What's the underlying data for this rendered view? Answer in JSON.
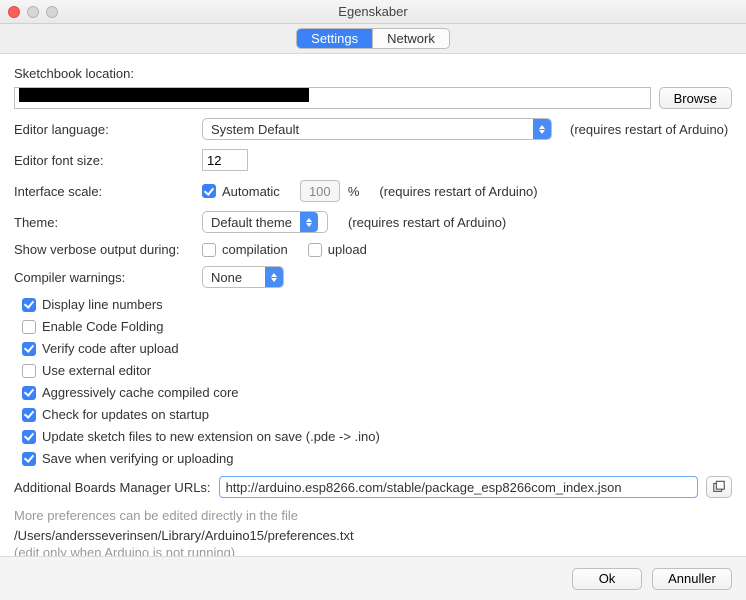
{
  "window": {
    "title": "Egenskaber"
  },
  "tabs": {
    "settings": "Settings",
    "network": "Network"
  },
  "labels": {
    "sketchbook": "Sketchbook location:",
    "language": "Editor language:",
    "fontsize": "Editor font size:",
    "interface_scale": "Interface scale:",
    "theme": "Theme:",
    "verbose": "Show verbose output during:",
    "compiler_warnings": "Compiler warnings:",
    "boards_url": "Additional Boards Manager URLs:"
  },
  "values": {
    "language": "System Default",
    "fontsize": "12",
    "scale_auto": "Automatic",
    "scale_pct": "100",
    "scale_pct_suffix": "%",
    "theme": "Default theme",
    "verbose_compile": "compilation",
    "verbose_upload": "upload",
    "compiler_warnings": "None",
    "boards_url": "http://arduino.esp8266.com/stable/package_esp8266com_index.json"
  },
  "hints": {
    "restart": "(requires restart of Arduino)"
  },
  "options": {
    "display_line_numbers": "Display line numbers",
    "enable_code_folding": "Enable Code Folding",
    "verify_after_upload": "Verify code after upload",
    "use_external_editor": "Use external editor",
    "cache_core": "Aggressively cache compiled core",
    "check_updates": "Check for updates on startup",
    "update_ext": "Update sketch files to new extension on save (.pde -> .ino)",
    "save_on_verify": "Save when verifying or uploading"
  },
  "footer": {
    "note1": "More preferences can be edited directly in the file",
    "path": "/Users/andersseverinsen/Library/Arduino15/preferences.txt",
    "note2": "(edit only when Arduino is not running)"
  },
  "buttons": {
    "browse": "Browse",
    "ok": "Ok",
    "cancel": "Annuller"
  }
}
